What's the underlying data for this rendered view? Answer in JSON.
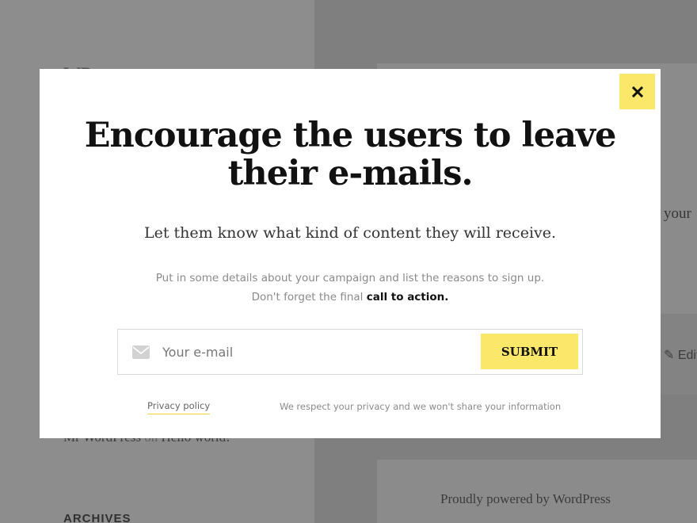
{
  "background": {
    "site_title_fragment": "WP",
    "content_fragment": "your",
    "edit_link": "Edit",
    "recent_comment": {
      "author": "Mr WordPress",
      "on": "on",
      "post": "Hello world!"
    },
    "archives_heading": "ARCHIVES",
    "footer_text": "Proudly powered by WordPress"
  },
  "modal": {
    "close_icon": "close-icon",
    "headline_normal": "Encourage the users ",
    "headline_bold": "to leave",
    "headline_line2": "their e-mails.",
    "subhead": "Let them know what kind of content they will receive.",
    "details_line1": "Put in some details about your campaign and list the reasons to sign up.",
    "details_line2_prefix": "Don't forget the final ",
    "details_line2_cta": "call to action.",
    "form": {
      "email_placeholder": "Your e-mail",
      "email_value": "",
      "mail_icon": "envelope-icon",
      "submit_label": "SUBMIT"
    },
    "privacy_link": "Privacy policy",
    "privacy_note": "We respect your privacy and we won't share your information"
  },
  "colors": {
    "accent": "#fbe76a",
    "overlay": "#878787",
    "modal_bg": "#ffffff"
  }
}
